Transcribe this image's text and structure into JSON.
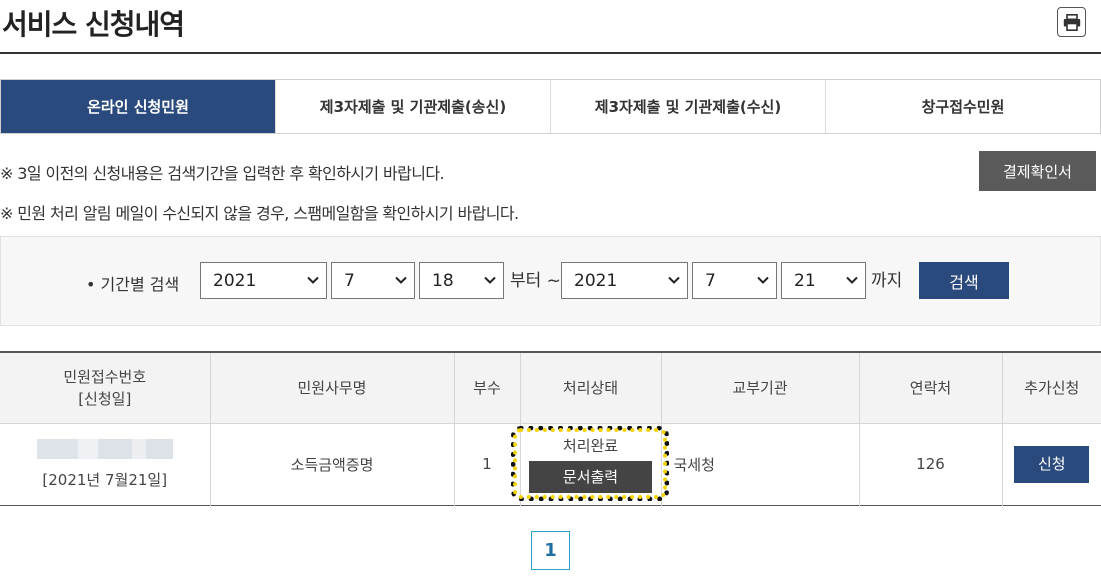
{
  "header": {
    "title": "서비스 신청내역",
    "print_icon": "printer-icon"
  },
  "tabs": [
    {
      "label": "온라인 신청민원",
      "active": true
    },
    {
      "label": "제3자제출 및 기관제출(송신)",
      "active": false
    },
    {
      "label": "제3자제출 및 기관제출(수신)",
      "active": false
    },
    {
      "label": "창구접수민원",
      "active": false
    }
  ],
  "notices": {
    "line1": "※ 3일 이전의 신청내용은 검색기간을 입력한 후 확인하시기 바랍니다.",
    "line2": "※ 민원 처리 알림 메일이 수신되지 않을 경우, 스팸메일함을 확인하시기 바랍니다."
  },
  "receipt_button": "결제확인서",
  "search": {
    "label": "• 기간별 검색",
    "from_year": "2021",
    "from_month": "7",
    "from_day": "18",
    "from_suffix": "부터 ~",
    "to_year": "2021",
    "to_month": "7",
    "to_day": "21",
    "to_suffix": "까지",
    "button": "검색"
  },
  "table": {
    "headers": {
      "receipt_no_line1": "민원접수번호",
      "receipt_no_line2": "[신청일]",
      "task_name": "민원사무명",
      "copies": "부수",
      "status": "처리상태",
      "agency": "교부기관",
      "contact": "연락처",
      "extra": "추가신청"
    },
    "rows": [
      {
        "date": "[2021년 7월21일]",
        "task_name": "소득금액증명",
        "copies": "1",
        "status": "처리완료",
        "print_button": "문서출력",
        "agency": "국세청",
        "contact": "126",
        "apply_button": "신청"
      }
    ]
  },
  "pagination": {
    "current": "1"
  },
  "colors": {
    "primary": "#2a4a7d",
    "dark_button": "#444444",
    "highlight": "#f3d400"
  }
}
